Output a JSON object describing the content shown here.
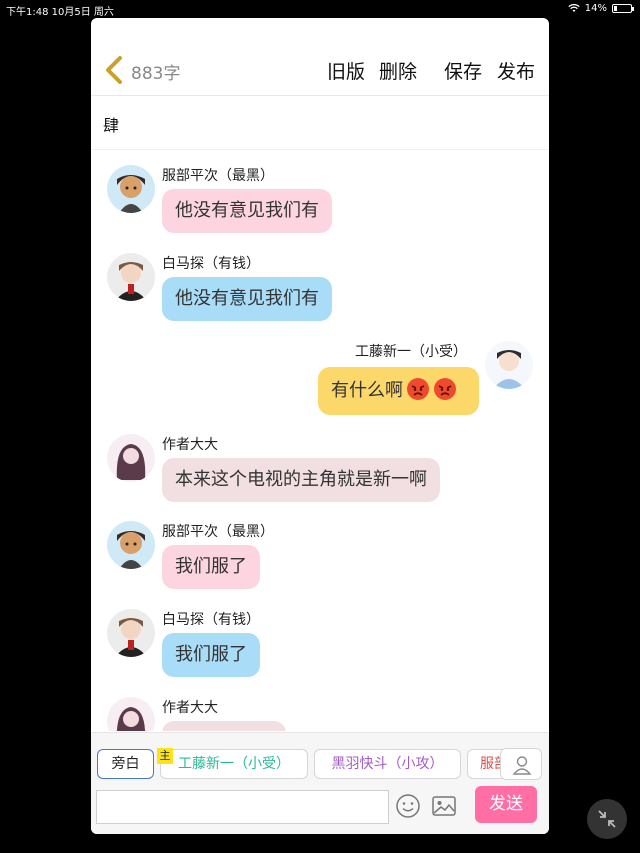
{
  "status_bar": {
    "time_date": "下午1:48  10月5日 周六",
    "battery": "14%"
  },
  "header": {
    "word_count": "883字",
    "buttons": {
      "old_version": "旧版",
      "delete": "删除",
      "save": "保存",
      "publish": "发布"
    }
  },
  "title": "肆",
  "messages": [
    {
      "name": "服部平次（最黑）",
      "text": "他没有意见我们有"
    },
    {
      "name": "白马探（有钱）",
      "text": "他没有意见我们有"
    },
    {
      "name": "工藤新一（小受）",
      "text": "有什么啊"
    },
    {
      "name": "作者大大",
      "text": "本来这个电视的主角就是新一啊"
    },
    {
      "name": "服部平次（最黑）",
      "text": "我们服了"
    },
    {
      "name": "白马探（有钱）",
      "text": "我们服了"
    },
    {
      "name": "作者大大",
      "text": ""
    }
  ],
  "role_bar": {
    "narration": "旁白",
    "main_tag": "主",
    "roles": [
      "工藤新一（小受）",
      "黑羽快斗（小攻）",
      "服部"
    ]
  },
  "composer": {
    "input_value": "",
    "send_label": "发送"
  },
  "icons": {
    "back": "chevron-left-icon",
    "emoji": "smiley-icon",
    "image": "image-icon",
    "person": "person-icon",
    "float": "collapse-icon",
    "angry": "angry-face-icon"
  },
  "colors": {
    "accent_pink": "#ff6fa6",
    "bubble_pink": "#fdd5e1",
    "bubble_blue": "#a9dcf6",
    "bubble_yellow": "#fcd86a",
    "bubble_rose": "#f1dfe2",
    "back_arrow": "#c9a227",
    "role_green": "#2eb89a",
    "role_purple": "#a15cc7"
  }
}
